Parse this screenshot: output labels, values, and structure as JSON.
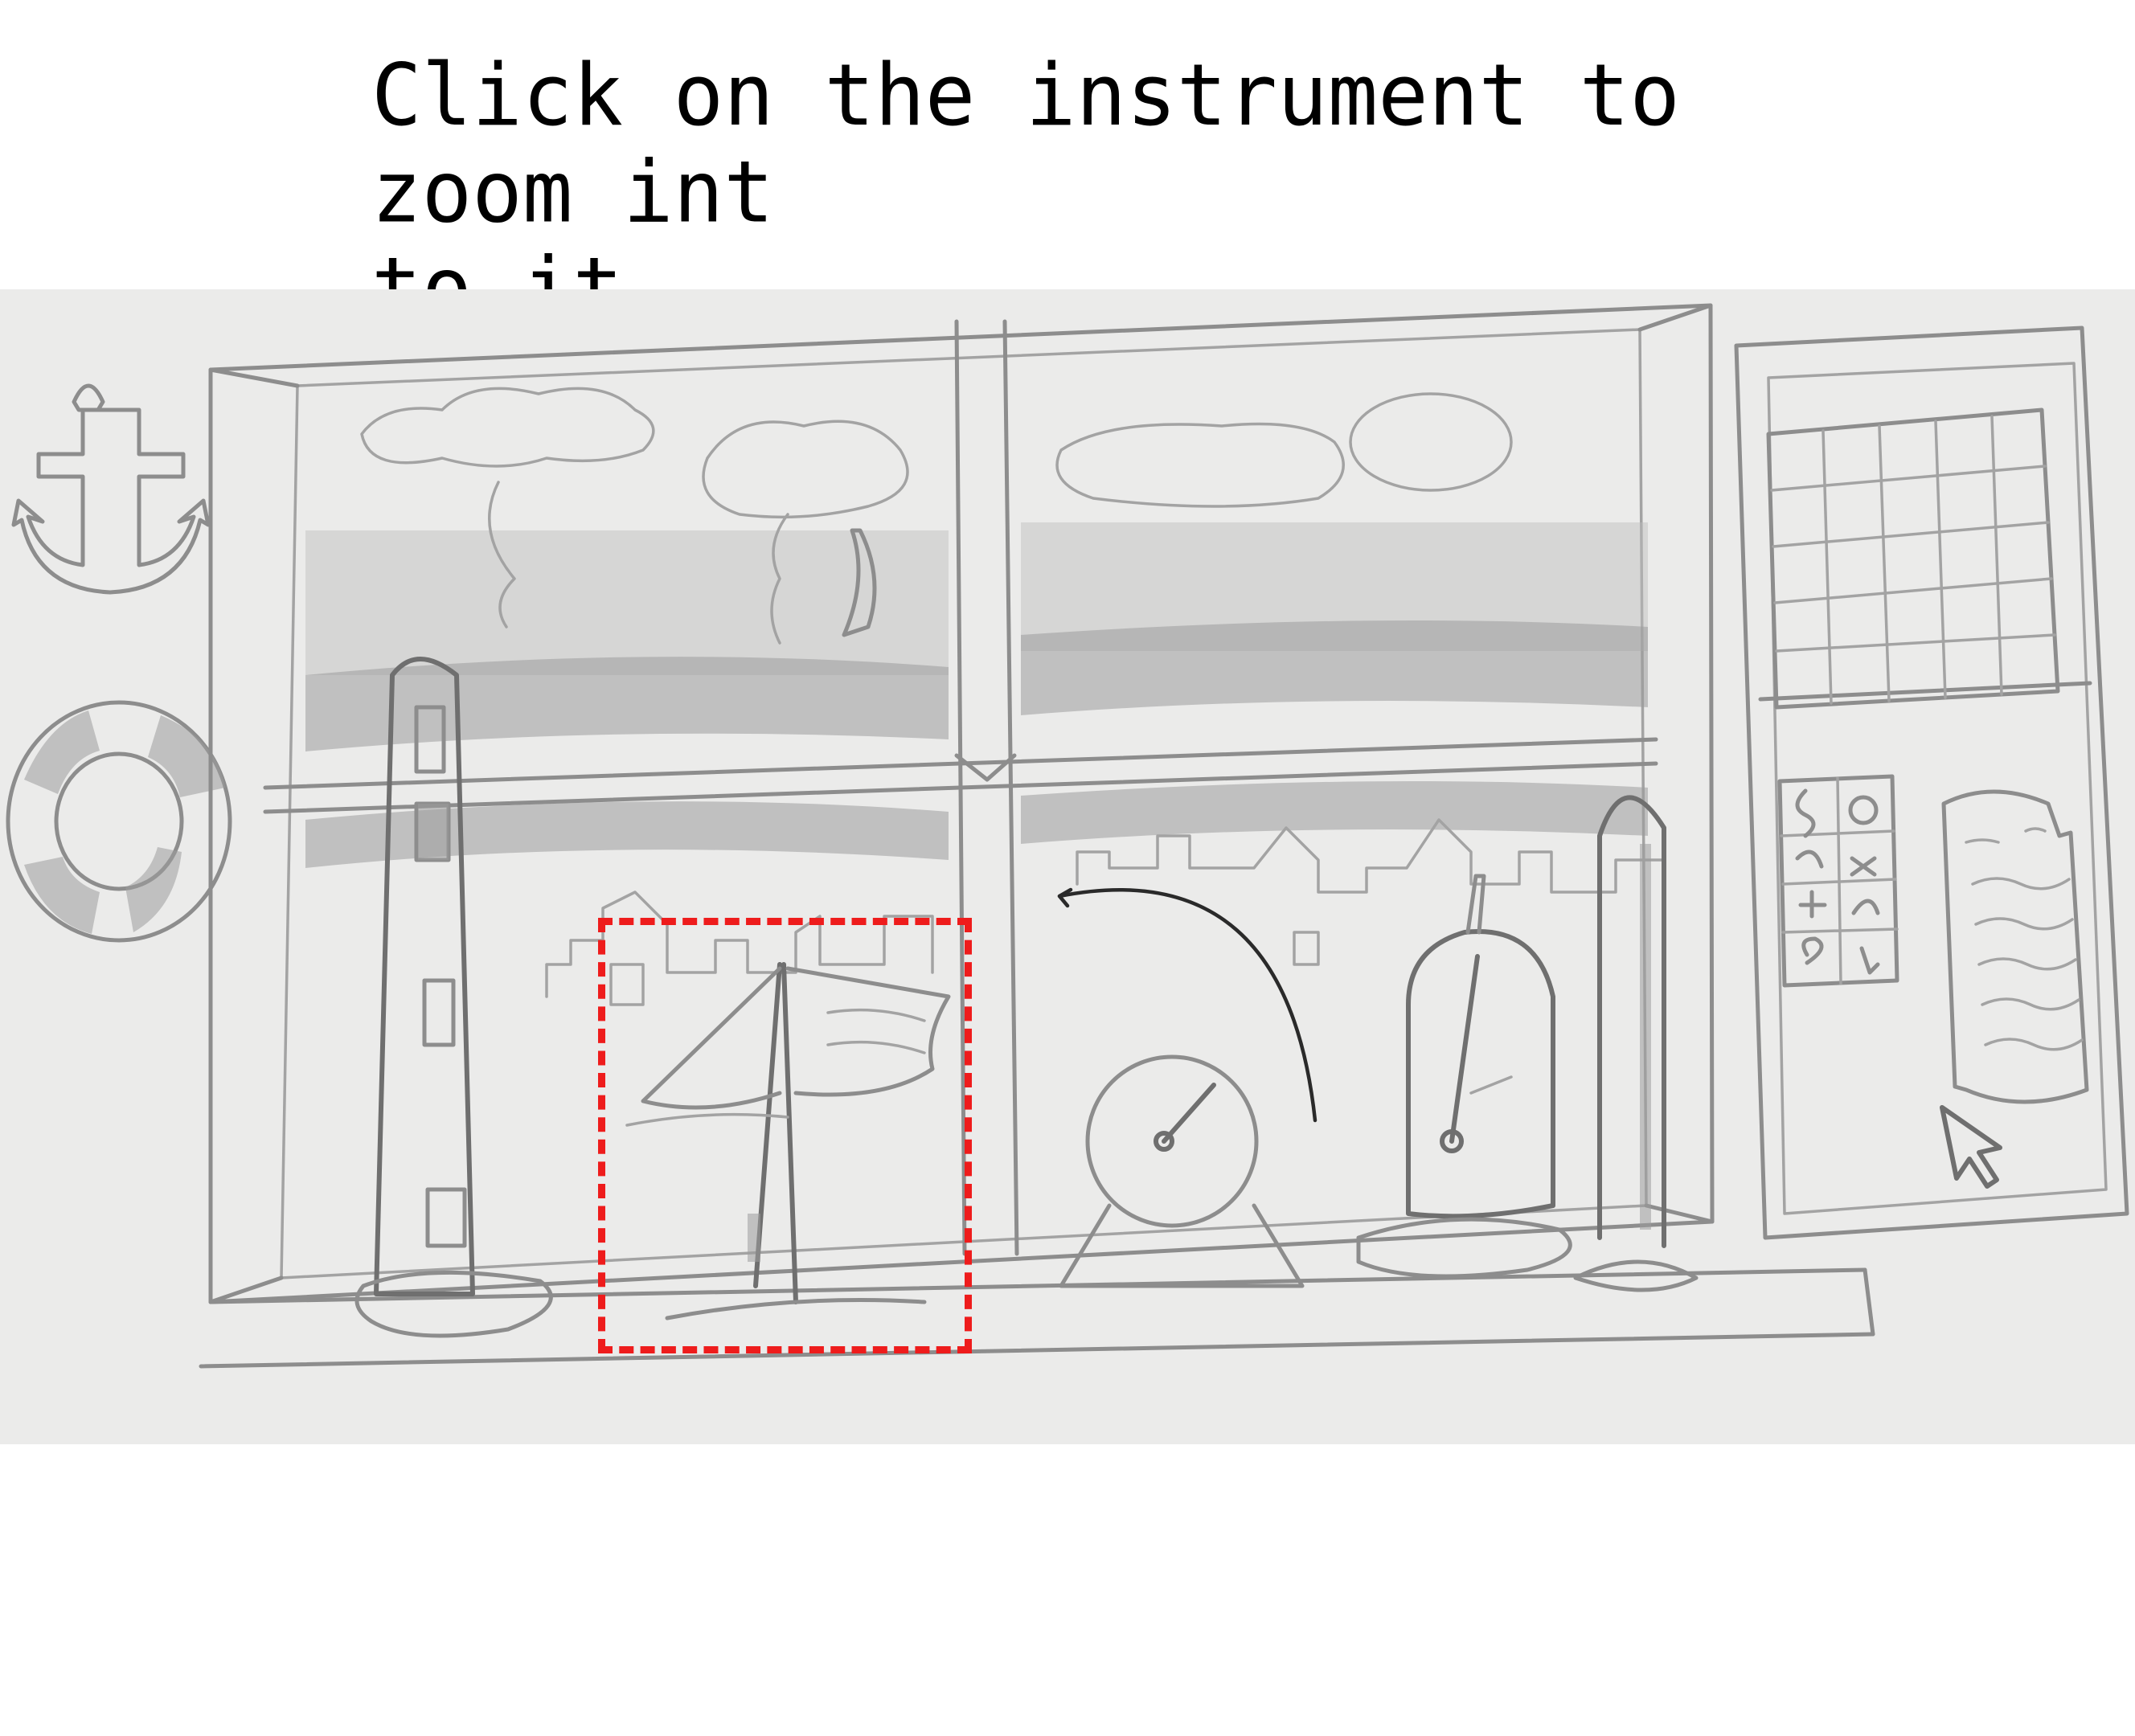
{
  "header": {
    "instruction": "Click on the instrument to zoom int\nto it"
  },
  "scene": {
    "instruments": [
      {
        "id": "lighthouse-tower",
        "icon": "tower-instrument-icon"
      },
      {
        "id": "sail-boat",
        "icon": "sailboat-instrument-icon",
        "selected": true
      },
      {
        "id": "round-dial",
        "icon": "dial-gauge-icon"
      },
      {
        "id": "barometer",
        "icon": "barometer-icon"
      },
      {
        "id": "thermometer",
        "icon": "thermometer-icon"
      }
    ],
    "wall_items": [
      "anchor-icon",
      "life-ring-icon",
      "calendar-grid-icon",
      "weather-symbols-chart-icon",
      "note-paper-icon"
    ],
    "cursor": "mouse-pointer-icon"
  },
  "colors": {
    "selection": "#ee1c1c",
    "paper": "#ebebea",
    "pencil": "#8d8d8d"
  }
}
